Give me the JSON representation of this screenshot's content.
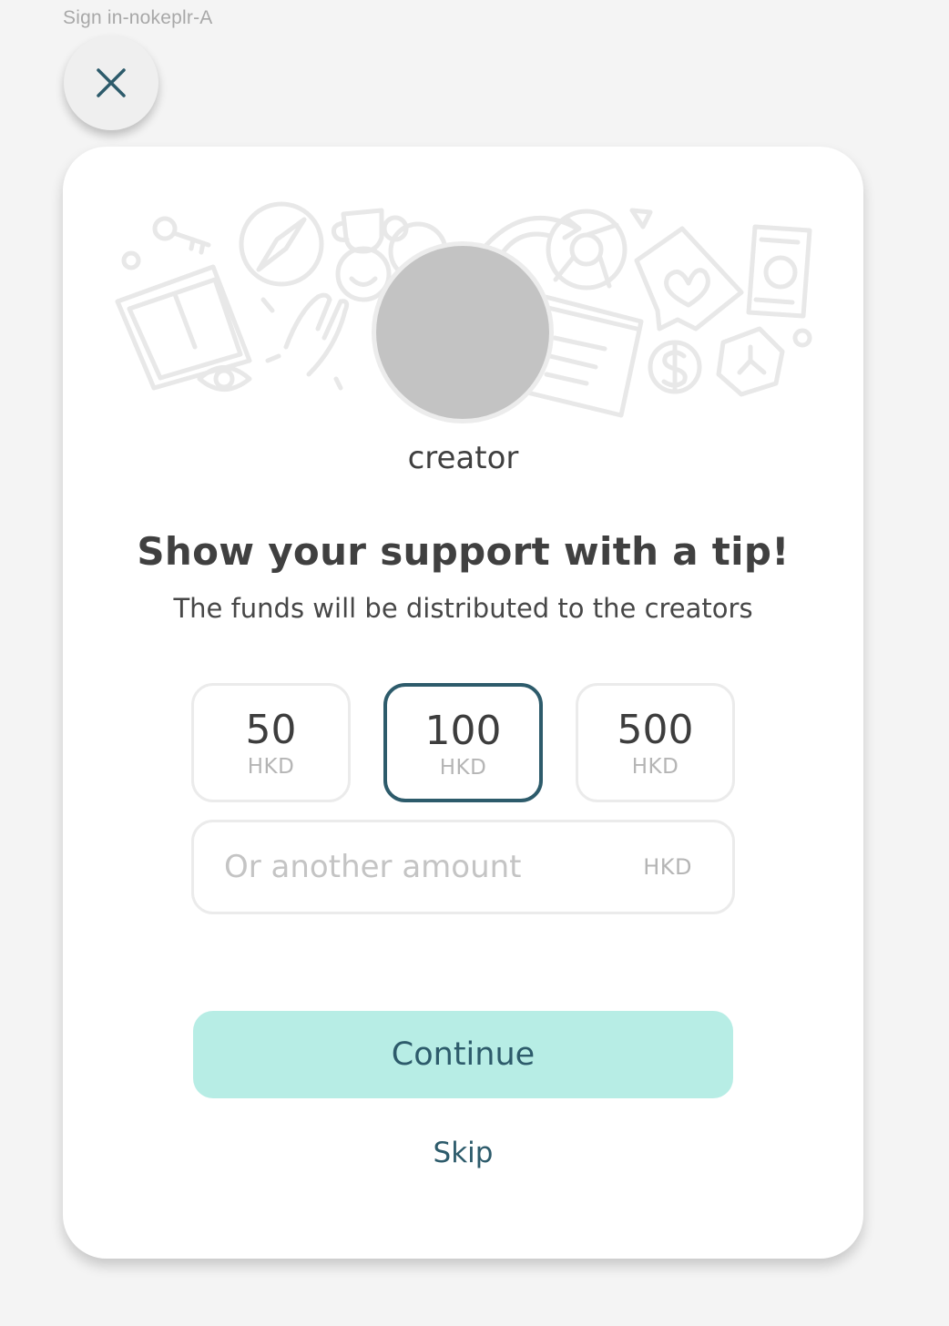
{
  "frame_label": "Sign in-nokeplr-A",
  "close_button": {
    "icon": "close-icon"
  },
  "creator": {
    "name": "creator"
  },
  "tip": {
    "heading": "Show your support with a tip!",
    "subtext": "The funds will be distributed to the creators",
    "amounts": [
      {
        "value": "50",
        "currency": "HKD",
        "selected": false
      },
      {
        "value": "100",
        "currency": "HKD",
        "selected": true
      },
      {
        "value": "500",
        "currency": "HKD",
        "selected": false
      }
    ],
    "custom_amount": {
      "placeholder": "Or another amount",
      "value": "",
      "currency": "HKD"
    }
  },
  "actions": {
    "continue_label": "Continue",
    "skip_label": "Skip"
  },
  "colors": {
    "accent": "#2d5b6b",
    "continue_bg": "#b7ede5",
    "page_bg": "#f4f4f4",
    "avatar_placeholder": "#c3c3c3"
  }
}
